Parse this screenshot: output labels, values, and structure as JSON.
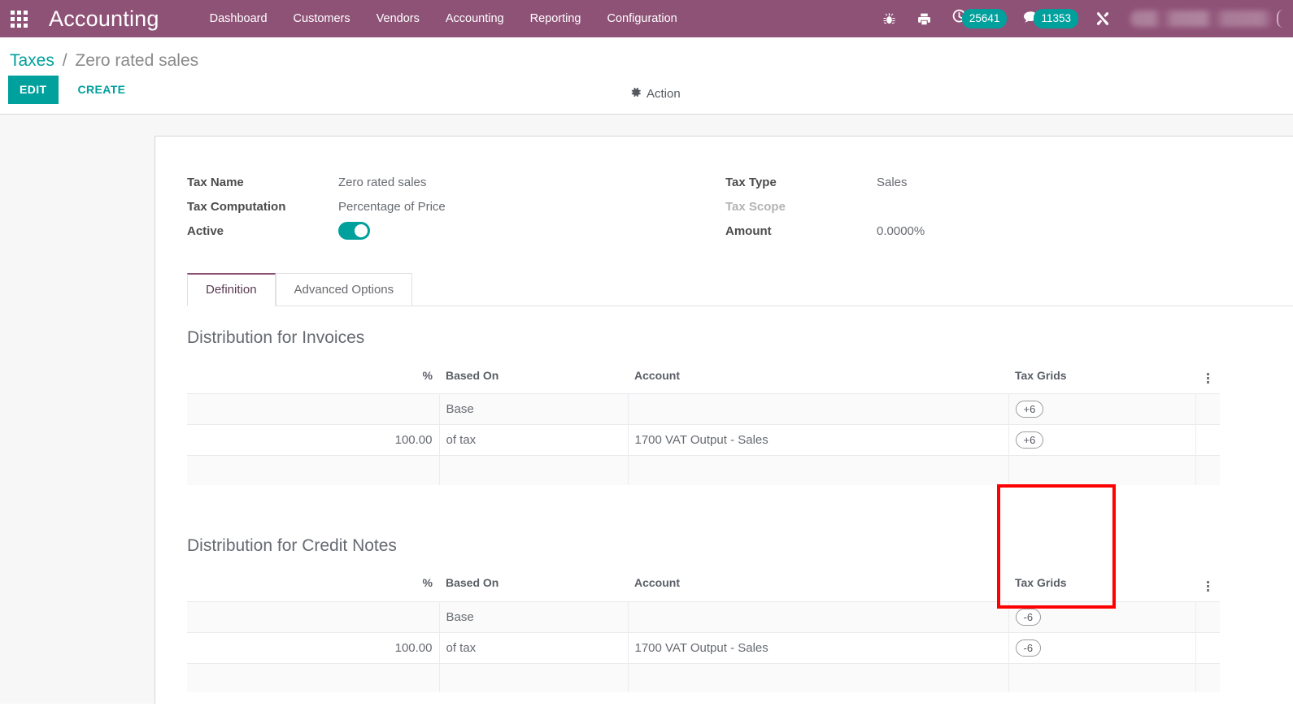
{
  "navbar": {
    "apps_icon": "apps-grid-icon",
    "brand": "Accounting",
    "menu": [
      {
        "label": "Dashboard"
      },
      {
        "label": "Customers"
      },
      {
        "label": "Vendors"
      },
      {
        "label": "Accounting"
      },
      {
        "label": "Reporting"
      },
      {
        "label": "Configuration"
      }
    ],
    "icons": {
      "debug": "bug-icon",
      "print": "printer-icon",
      "activities": "clock-icon",
      "messages": "chat-icon",
      "tools": "wrench-icon"
    },
    "activities_count": "25641",
    "messages_count": "11353",
    "user_name": "",
    "brand_color": "#8f5277",
    "badge_color": "#00a09d"
  },
  "control_panel": {
    "breadcrumb": {
      "parent": "Taxes",
      "separator": "/",
      "current": "Zero rated sales"
    },
    "edit_label": "EDIT",
    "create_label": "CREATE",
    "action_label": "Action",
    "action_icon": "gear-icon",
    "accent_color": "#00a09d"
  },
  "form": {
    "left": [
      {
        "label": "Tax Name",
        "value": "Zero rated sales",
        "type": "text"
      },
      {
        "label": "Tax Computation",
        "value": "Percentage of Price",
        "type": "text"
      },
      {
        "label": "Active",
        "value": "on",
        "type": "toggle"
      }
    ],
    "right": [
      {
        "label": "Tax Type",
        "value": "Sales",
        "type": "text",
        "muted_label": false
      },
      {
        "label": "Tax Scope",
        "value": "",
        "type": "text",
        "muted_label": true
      },
      {
        "label": "Amount",
        "value": "0.0000%",
        "type": "text",
        "muted_label": false
      }
    ]
  },
  "tabs": [
    {
      "label": "Definition",
      "active": true
    },
    {
      "label": "Advanced Options",
      "active": false
    }
  ],
  "distributions": [
    {
      "title": "Distribution for Invoices",
      "columns": {
        "pct": "%",
        "based_on": "Based On",
        "account": "Account",
        "tax_grids": "Tax Grids"
      },
      "rows": [
        {
          "pct": "",
          "based_on": "Base",
          "account": "",
          "tax_grid": "+6"
        },
        {
          "pct": "100.00",
          "based_on": "of tax",
          "account": "1700 VAT Output - Sales",
          "tax_grid": "+6"
        }
      ]
    },
    {
      "title": "Distribution for Credit Notes",
      "columns": {
        "pct": "%",
        "based_on": "Based On",
        "account": "Account",
        "tax_grids": "Tax Grids"
      },
      "rows": [
        {
          "pct": "",
          "based_on": "Base",
          "account": "",
          "tax_grid": "-6"
        },
        {
          "pct": "100.00",
          "based_on": "of tax",
          "account": "1700 VAT Output - Sales",
          "tax_grid": "-6"
        }
      ]
    }
  ],
  "annotation": {
    "type": "red-rectangle-highlight",
    "target": "tax-grids-column-invoices",
    "color": "#fe0000"
  }
}
